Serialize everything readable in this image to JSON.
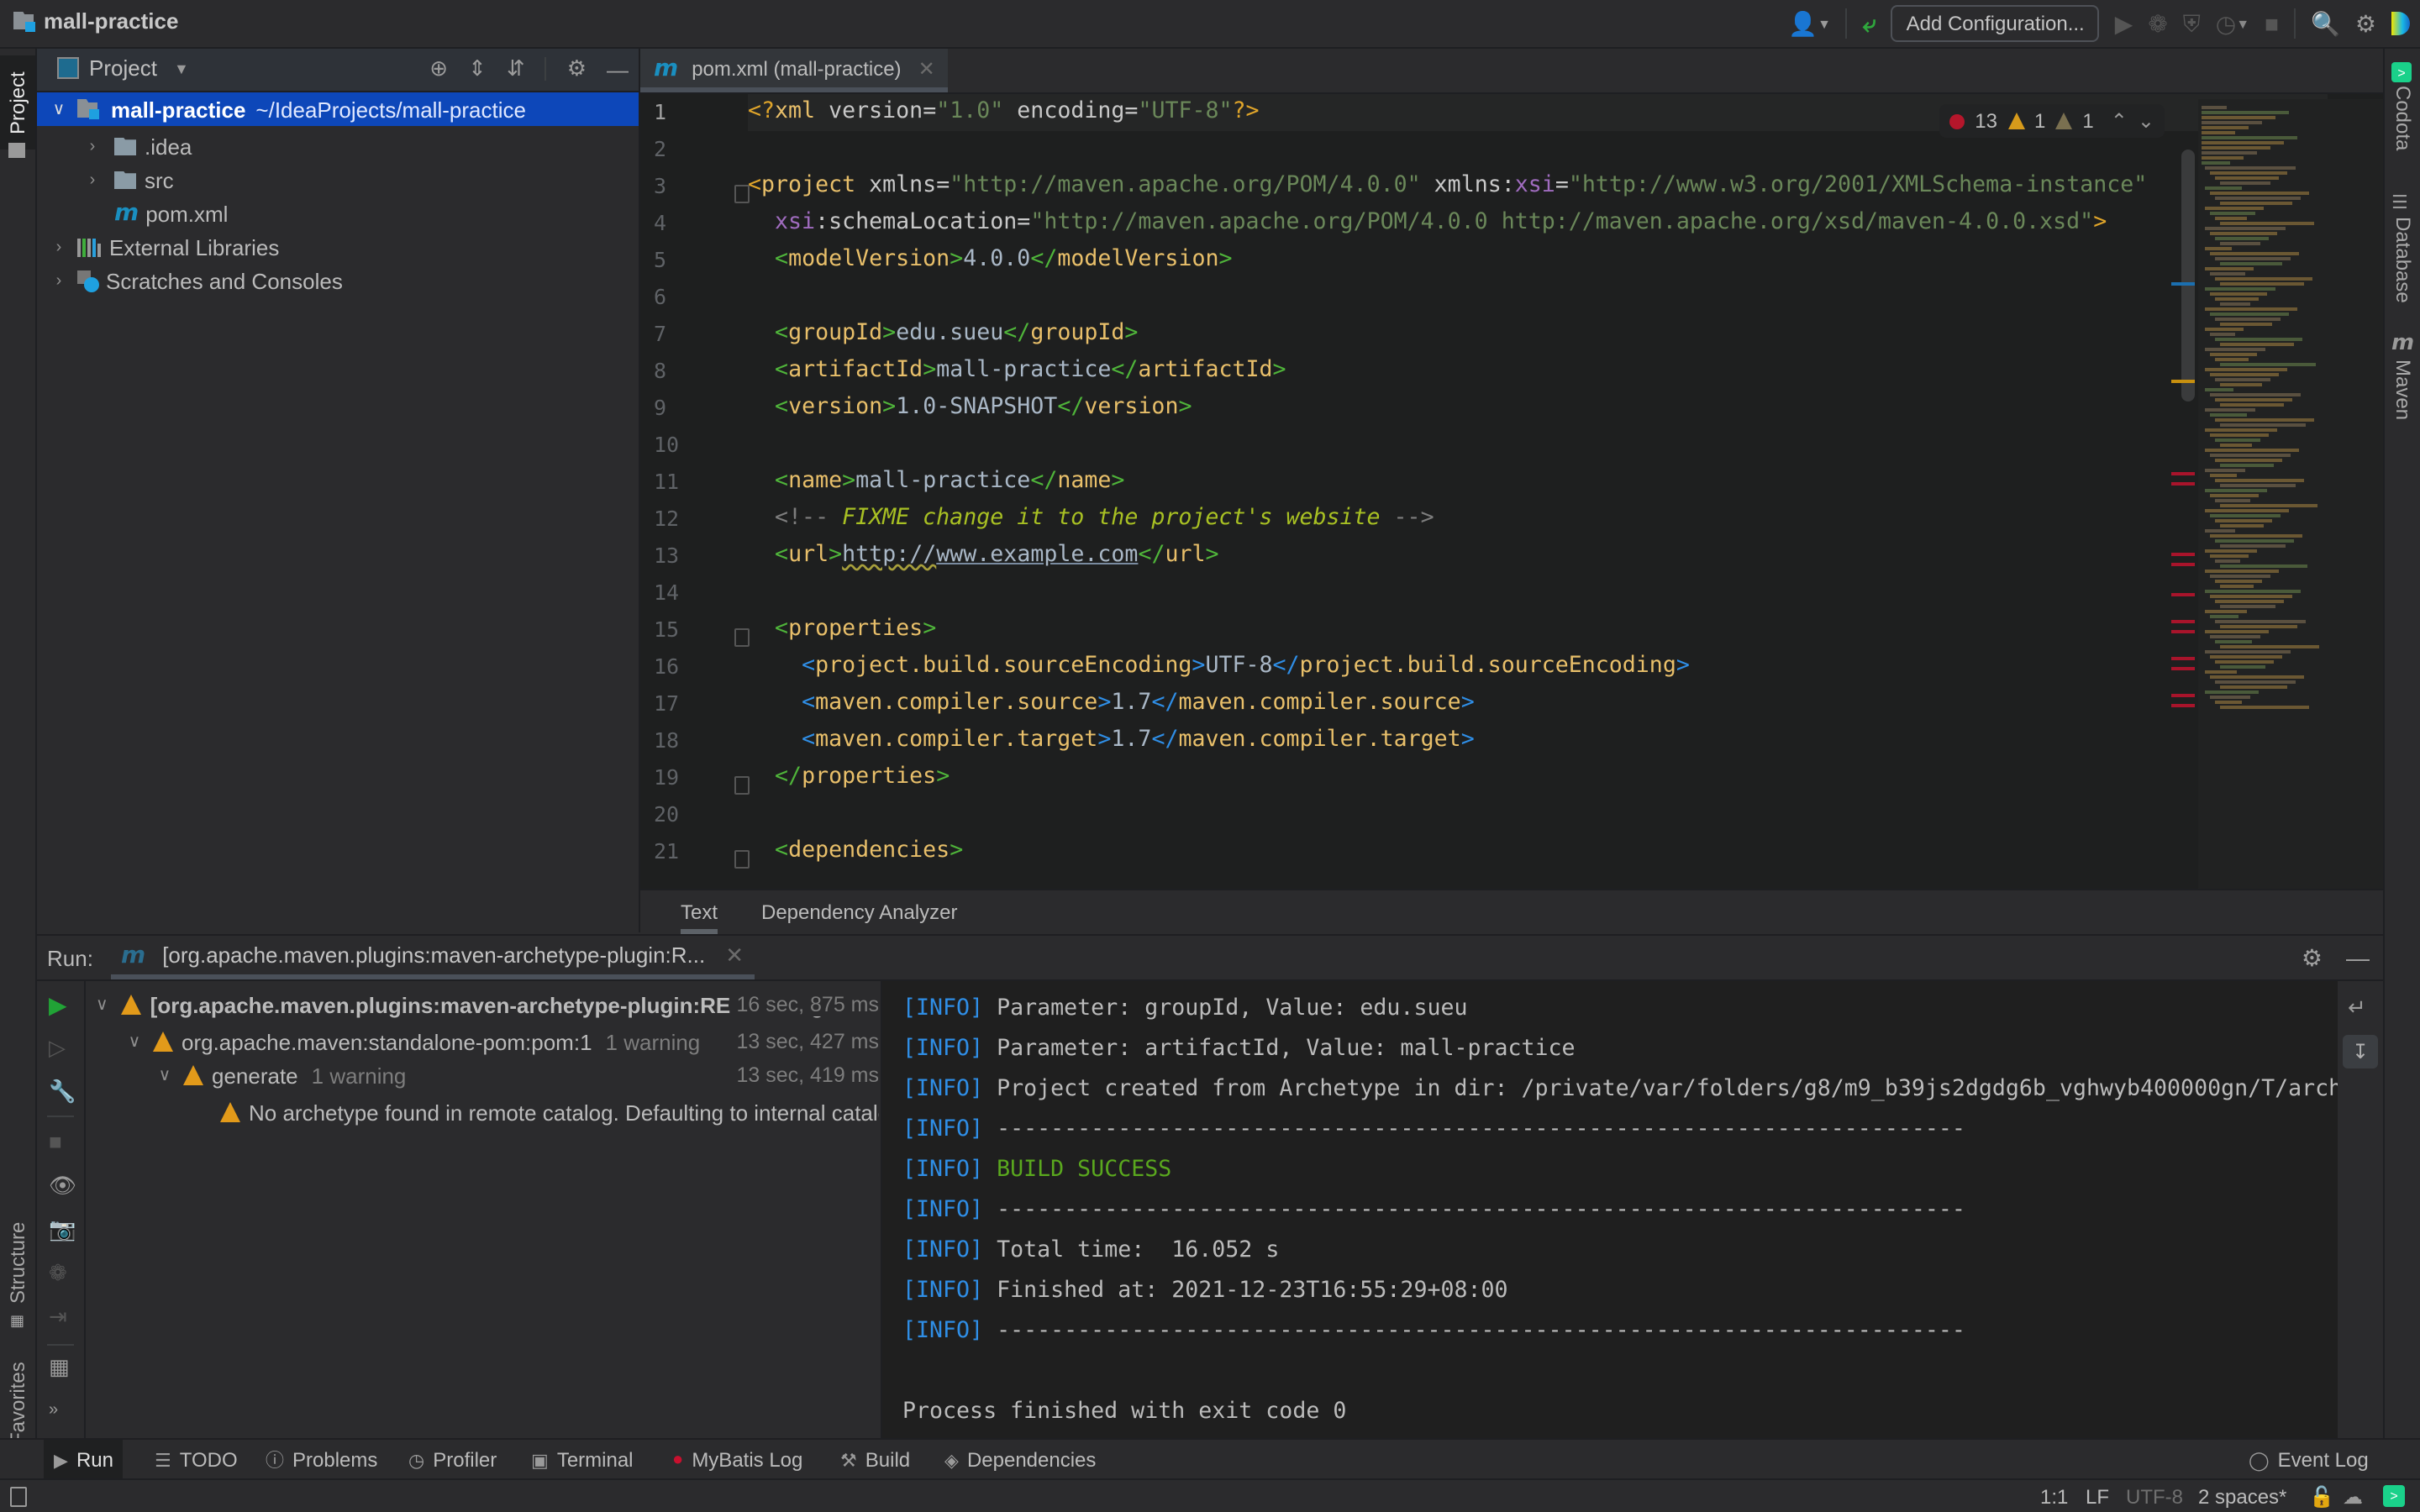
{
  "window": {
    "project_name": "mall-practice"
  },
  "navbar": {
    "add_configuration": "Add Configuration..."
  },
  "left_strip": {
    "project_tab": "Project",
    "structure_tab": "Structure",
    "favorites_tab": "Favorites"
  },
  "right_strip": {
    "codota_tab": "Codota",
    "database_tab": "Database",
    "maven_tab": "Maven"
  },
  "project_panel": {
    "title": "Project",
    "tree": [
      {
        "label": "mall-practice",
        "path": "~/IdeaProjects/mall-practice",
        "type": "project",
        "expanded": true,
        "selected": true
      },
      {
        "label": ".idea",
        "type": "folder",
        "expanded": false
      },
      {
        "label": "src",
        "type": "folder",
        "expanded": false
      },
      {
        "label": "pom.xml",
        "type": "maven-file"
      },
      {
        "label": "External Libraries",
        "type": "libraries",
        "expanded": false
      },
      {
        "label": "Scratches and Consoles",
        "type": "scratches",
        "expanded": false
      }
    ]
  },
  "editor": {
    "tab_label": "pom.xml (mall-practice)",
    "inspections": {
      "errors": "13",
      "warnings": "1",
      "weak_warnings": "1"
    },
    "line_numbers": [
      "1",
      "2",
      "3",
      "4",
      "5",
      "6",
      "7",
      "8",
      "9",
      "10",
      "11",
      "12",
      "13",
      "14",
      "15",
      "16",
      "17",
      "18",
      "19",
      "20",
      "21"
    ],
    "lines": {
      "l1": {
        "a": "<?",
        "b": "xml",
        "c": " version",
        "d": "=",
        "e": "\"1.0\"",
        "f": " encoding",
        "g": "=",
        "h": "\"UTF-8\"",
        "i": "?>"
      },
      "l3": {
        "tag": "project",
        "a1": " xmlns",
        "v1": "\"http://maven.apache.org/POM/4.0.0\"",
        "a2": " xmlns:",
        "ns": "xsi",
        "v2": "\"http://www.w3.org/2001/XMLSchema-instance\""
      },
      "l4": {
        "ns": "xsi",
        "a": ":schemaLocation",
        "v": "\"http://maven.apache.org/POM/4.0.0 http://maven.apache.org/xsd/maven-4.0.0.xsd\""
      },
      "l5": {
        "tag": "modelVersion",
        "val": "4.0.0"
      },
      "l7": {
        "tag": "groupId",
        "val": "edu.sueu"
      },
      "l8": {
        "tag": "artifactId",
        "val": "mall-practice"
      },
      "l9": {
        "tag": "version",
        "val": "1.0-SNAPSHOT"
      },
      "l11": {
        "tag": "name",
        "val": "mall-practice"
      },
      "l12": {
        "open": "<!-- ",
        "text": "FIXME change it to the project's website",
        "close": " -->"
      },
      "l13": {
        "tag": "url",
        "val_a": "http://",
        "val_b": "www.example.com"
      },
      "l15": {
        "tag": "properties"
      },
      "l16": {
        "tag": "project.build.sourceEncoding",
        "val": "UTF-8"
      },
      "l17": {
        "tag": "maven.compiler.source",
        "val": "1.7"
      },
      "l18": {
        "tag": "maven.compiler.target",
        "val": "1.7"
      },
      "l19": {
        "tag": "properties"
      },
      "l21": {
        "tag": "dependencies"
      }
    },
    "bottom_tabs": [
      "Text",
      "Dependency Analyzer"
    ],
    "active_bottom_tab": "Text"
  },
  "run_panel": {
    "label": "Run:",
    "tab_label": "[org.apache.maven.plugins:maven-archetype-plugin:R...",
    "tree": [
      {
        "label": "[org.apache.maven.plugins:maven-archetype-plugin:RELEASE:generate]",
        "time": "16 sec, 875 ms",
        "level": 0,
        "warning": true,
        "bold": true
      },
      {
        "label": "org.apache.maven:standalone-pom:pom:1",
        "extra": "1 warning",
        "time": "13 sec, 427 ms",
        "level": 1,
        "warning": true
      },
      {
        "label": "generate",
        "extra": "1 warning",
        "time": "13 sec, 419 ms",
        "level": 2,
        "warning": true
      },
      {
        "label": "No archetype found in remote catalog. Defaulting to internal catalog",
        "level": 3,
        "warning": true
      }
    ],
    "console": [
      {
        "prefix": "[INFO]",
        "text": " Parameter: groupId, Value: edu.sueu"
      },
      {
        "prefix": "[INFO]",
        "text": " Parameter: artifactId, Value: mall-practice"
      },
      {
        "prefix": "[INFO]",
        "text": " Project created from Archetype in dir: /private/var/folders/g8/m9_b39js2dgdg6b_vghwyb400000gn/T/archetypet"
      },
      {
        "prefix": "[INFO]",
        "text": " ------------------------------------------------------------------------"
      },
      {
        "prefix": "[INFO]",
        "text": " BUILD SUCCESS",
        "success": true
      },
      {
        "prefix": "[INFO]",
        "text": " ------------------------------------------------------------------------"
      },
      {
        "prefix": "[INFO]",
        "text": " Total time:  16.052 s"
      },
      {
        "prefix": "[INFO]",
        "text": " Finished at: 2021-12-23T16:55:29+08:00"
      },
      {
        "prefix": "[INFO]",
        "text": " ------------------------------------------------------------------------"
      },
      {
        "prefix": "",
        "text": ""
      },
      {
        "prefix": "",
        "text": "Process finished with exit code 0"
      }
    ]
  },
  "tool_windows": [
    {
      "label": "Run",
      "icon": "play-icon",
      "active": true
    },
    {
      "label": "TODO",
      "icon": "list-icon"
    },
    {
      "label": "Problems",
      "icon": "problems-icon"
    },
    {
      "label": "Profiler",
      "icon": "profiler-icon"
    },
    {
      "label": "Terminal",
      "icon": "terminal-icon"
    },
    {
      "label": "MyBatis Log",
      "icon": "mybatis-icon"
    },
    {
      "label": "Build",
      "icon": "hammer-icon"
    },
    {
      "label": "Dependencies",
      "icon": "dependencies-icon"
    }
  ],
  "event_log": "Event Log",
  "status_bar": {
    "position": "1:1",
    "line_separator": "LF",
    "encoding": "UTF-8",
    "indent": "2 spaces*"
  },
  "colors": {
    "selection": "#0d47b9",
    "success": "#5aa81e",
    "info": "#2f8ee6",
    "error": "#b5162b",
    "warning": "#e29a1a",
    "run_green": "#21a336"
  }
}
